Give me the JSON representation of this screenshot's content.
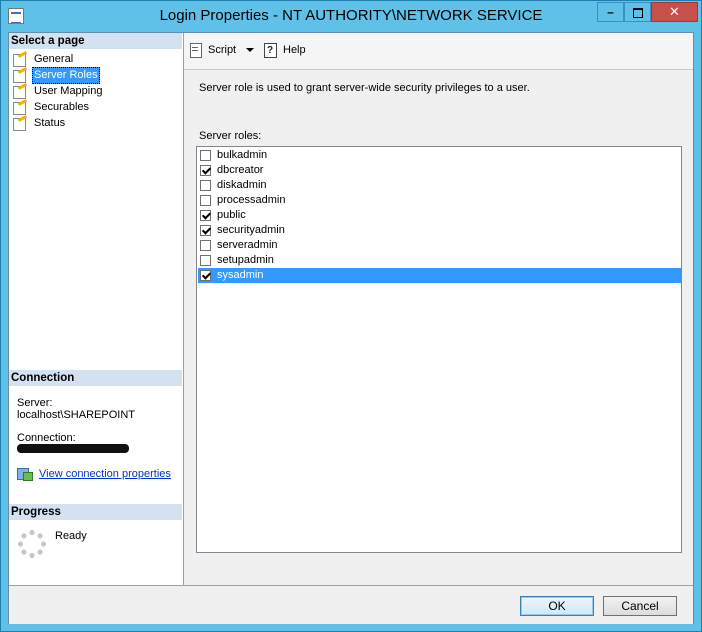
{
  "window": {
    "title": "Login Properties - NT AUTHORITY\\NETWORK SERVICE",
    "minimize_glyph": "–",
    "close_glyph": "✕"
  },
  "left_pane": {
    "select_page_header": "Select a page",
    "pages": [
      {
        "label": "General",
        "selected": false
      },
      {
        "label": "Server Roles",
        "selected": true
      },
      {
        "label": "User Mapping",
        "selected": false
      },
      {
        "label": "Securables",
        "selected": false
      },
      {
        "label": "Status",
        "selected": false
      }
    ],
    "connection_header": "Connection",
    "server_label": "Server:",
    "server_value": "localhost\\SHAREPOINT",
    "connection_label": "Connection:",
    "view_connection_link": "View connection properties",
    "progress_header": "Progress",
    "progress_status": "Ready"
  },
  "toolbar": {
    "script_label": "Script",
    "help_label": "Help"
  },
  "content": {
    "description": "Server role is used to grant server-wide security privileges to a user.",
    "roles_label": "Server roles:",
    "roles": [
      {
        "name": "bulkadmin",
        "checked": false,
        "selected": false
      },
      {
        "name": "dbcreator",
        "checked": true,
        "selected": false
      },
      {
        "name": "diskadmin",
        "checked": false,
        "selected": false
      },
      {
        "name": "processadmin",
        "checked": false,
        "selected": false
      },
      {
        "name": "public",
        "checked": true,
        "selected": false
      },
      {
        "name": "securityadmin",
        "checked": true,
        "selected": false
      },
      {
        "name": "serveradmin",
        "checked": false,
        "selected": false
      },
      {
        "name": "setupadmin",
        "checked": false,
        "selected": false
      },
      {
        "name": "sysadmin",
        "checked": true,
        "selected": true
      }
    ]
  },
  "footer": {
    "ok_label": "OK",
    "cancel_label": "Cancel"
  }
}
